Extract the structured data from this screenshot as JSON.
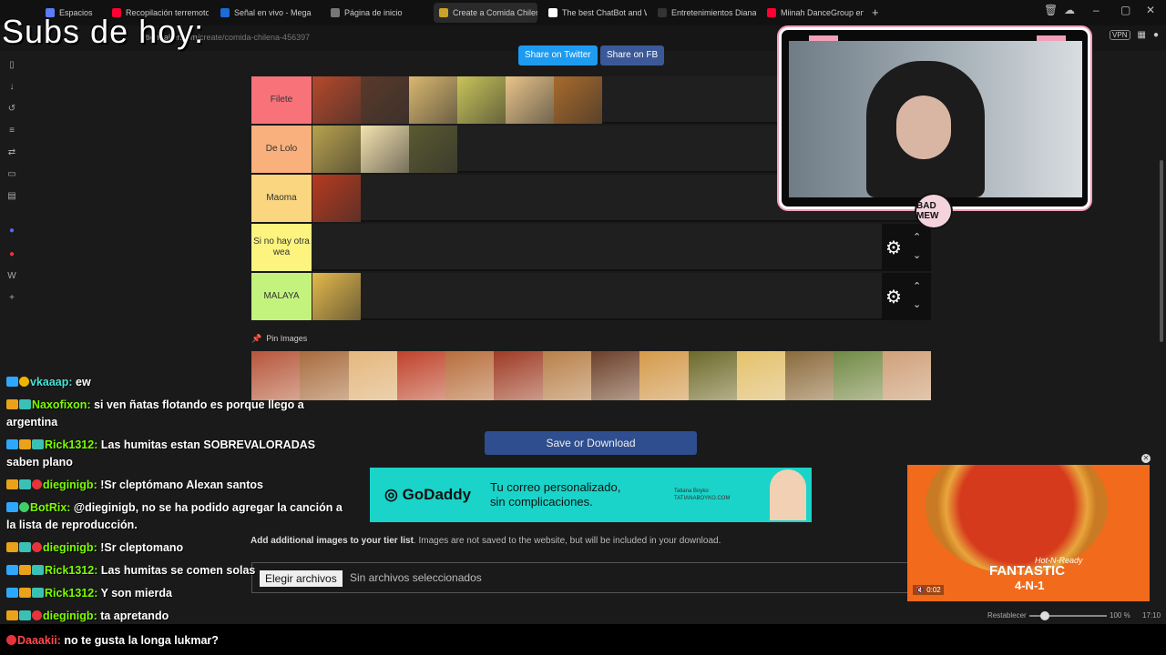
{
  "overlay": {
    "subs_text": "Subs de hoy:",
    "cam_logo": "BAD MEW"
  },
  "browser": {
    "tabs": [
      {
        "label": "Espacios",
        "color": "#5c7cfa"
      },
      {
        "label": "Recopilación terremoto ch",
        "color": "#ff0033"
      },
      {
        "label": "Señal en vivo - Mega",
        "color": "#1d6ad8"
      },
      {
        "label": "Página de inicio",
        "color": "#777777"
      },
      {
        "label": "Create a Comida Chilena T",
        "color": "#c9a227"
      },
      {
        "label": "The best ChatBot and Wid",
        "color": "#ffffff"
      },
      {
        "label": "Entretenimientos Diana",
        "color": "#333333"
      },
      {
        "label": "Miinah DanceGroup en Val",
        "color": "#ff0033"
      }
    ],
    "url_host": "tiermaker.com",
    "url_path": "/create/comida-chilena-456397",
    "vpn_label": "VPN"
  },
  "share": {
    "twitter": "Share on Twitter",
    "facebook": "Share on FB"
  },
  "tiers": [
    {
      "label": "Filete",
      "color": "#f8727a",
      "items": [
        "#b5492b",
        "#5a3a2a",
        "#d9b870",
        "#c8c45a",
        "#e8c48a",
        "#a86a2c"
      ]
    },
    {
      "label": "De Lolo",
      "color": "#f9b07c",
      "items": [
        "#b8a24e",
        "#f4e3b0",
        "#5a5a32"
      ]
    },
    {
      "label": "Maoma",
      "color": "#f9d67f",
      "items": [
        "#b73a1f"
      ]
    },
    {
      "label": "Si no hay otra wea",
      "color": "#fdf37f",
      "items": []
    },
    {
      "label": "MALAYA",
      "color": "#c3f37d",
      "items": [
        "#e3b94c"
      ]
    }
  ],
  "pin": {
    "label": "Pin Images",
    "items": [
      "#b7553b",
      "#a86b3e",
      "#e5b77c",
      "#c0412b",
      "#b86d3c",
      "#9e3a25",
      "#b8804a",
      "#6a3f2b",
      "#d59a4a",
      "#6b6a2a",
      "#e5c26a",
      "#8a6a3c",
      "#6f8a45",
      "#d0a07a"
    ]
  },
  "save_label": "Save or Download",
  "ad_godaddy": {
    "brand": "GoDaddy",
    "line1": "Tu correo personalizado,",
    "line2": "sin complicaciones.",
    "small_name": "Tatiana Boyko",
    "small_site": "TATIANABOYKO.COM"
  },
  "add_images": {
    "bold": "Add additional images to your tier list",
    "rest": ". Images are not saved to the website, but will be included in your download.",
    "file_button": "Elegir archivos",
    "file_status": "Sin archivos seleccionados"
  },
  "pizza_ad": {
    "hot": "Hot-N-Ready",
    "headline": "FANTASTIC",
    "sub": "4-N-1",
    "time": "0:02"
  },
  "statusbar": {
    "reset": "Restablecer",
    "zoom": "100 %",
    "time": "17:10"
  },
  "chat": [
    {
      "user": "vkaaap",
      "color": "#45e3d8",
      "badges": [
        "b-sword",
        "b-gold"
      ],
      "text": "ew"
    },
    {
      "user": "Naxofixon",
      "color": "#7cfc00",
      "badges": [
        "b-crown",
        "b-bars"
      ],
      "text": "si ven ñatas flotando es porque llego a"
    },
    {
      "user": "",
      "color": "#ffffff",
      "badges": [],
      "text": "argentina"
    },
    {
      "user": "Rick1312",
      "color": "#7cfc00",
      "badges": [
        "b-sword",
        "b-crown",
        "b-bars"
      ],
      "text": "Las humitas estan SOBREVALORADAS"
    },
    {
      "user": "",
      "color": "#ffffff",
      "badges": [],
      "text": "saben plano"
    },
    {
      "user": "dieginigb",
      "color": "#7cfc00",
      "badges": [
        "b-crown",
        "b-bars",
        "b-red"
      ],
      "text": "!Sr cleptómano Alexan santos"
    },
    {
      "user": "BotRix",
      "color": "#7cfc00",
      "badges": [
        "b-sword",
        "b-green"
      ],
      "text": "@dieginigb, no se ha podido agregar la canción a"
    },
    {
      "user": "",
      "color": "#ffffff",
      "badges": [],
      "text": "la lista de reproducción."
    },
    {
      "user": "dieginigb",
      "color": "#7cfc00",
      "badges": [
        "b-crown",
        "b-bars",
        "b-red"
      ],
      "text": "!Sr cleptomano"
    },
    {
      "user": "Rick1312",
      "color": "#7cfc00",
      "badges": [
        "b-sword",
        "b-crown",
        "b-bars"
      ],
      "text": "Las humitas se comen solas"
    },
    {
      "user": "Rick1312",
      "color": "#7cfc00",
      "badges": [
        "b-sword",
        "b-crown",
        "b-bars"
      ],
      "text": "Y son mierda"
    },
    {
      "user": "dieginigb",
      "color": "#7cfc00",
      "badges": [
        "b-crown",
        "b-bars",
        "b-red"
      ],
      "text": "ta apretando"
    },
    {
      "user": "Daaakii",
      "color": "#ff4a4a",
      "badges": [
        "b-red"
      ],
      "text": "no te gusta la longa lukmar?"
    }
  ]
}
